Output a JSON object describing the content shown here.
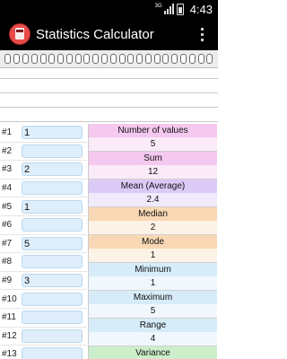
{
  "status_bar": {
    "network": "3G",
    "time": "4:43"
  },
  "app": {
    "title": "Statistics Calculator",
    "icon": "calculator-icon",
    "menu_icon": "overflow-menu-icon"
  },
  "values": [
    {
      "label": "#1",
      "value": "1"
    },
    {
      "label": "#2",
      "value": ""
    },
    {
      "label": "#3",
      "value": "2"
    },
    {
      "label": "#4",
      "value": ""
    },
    {
      "label": "#5",
      "value": "1"
    },
    {
      "label": "#6",
      "value": ""
    },
    {
      "label": "#7",
      "value": "5"
    },
    {
      "label": "#8",
      "value": ""
    },
    {
      "label": "#9",
      "value": "3"
    },
    {
      "label": "#10",
      "value": ""
    },
    {
      "label": "#11",
      "value": ""
    },
    {
      "label": "#12",
      "value": ""
    },
    {
      "label": "#13",
      "value": ""
    }
  ],
  "statistics": [
    {
      "label": "Number of values",
      "value": "5"
    },
    {
      "label": "Sum",
      "value": "12"
    },
    {
      "label": "Mean (Average)",
      "value": "2.4"
    },
    {
      "label": "Median",
      "value": "2"
    },
    {
      "label": "Mode",
      "value": "1"
    },
    {
      "label": "Minimum",
      "value": "1"
    },
    {
      "label": "Maximum",
      "value": "5"
    },
    {
      "label": "Range",
      "value": "4"
    },
    {
      "label": "Variance",
      "value": ""
    }
  ],
  "colors": {
    "pink": "#f4c8ef",
    "purple": "#dccaf6",
    "orange": "#f8d8b4",
    "blue": "#d6ecf8",
    "green": "#cdeecb"
  }
}
